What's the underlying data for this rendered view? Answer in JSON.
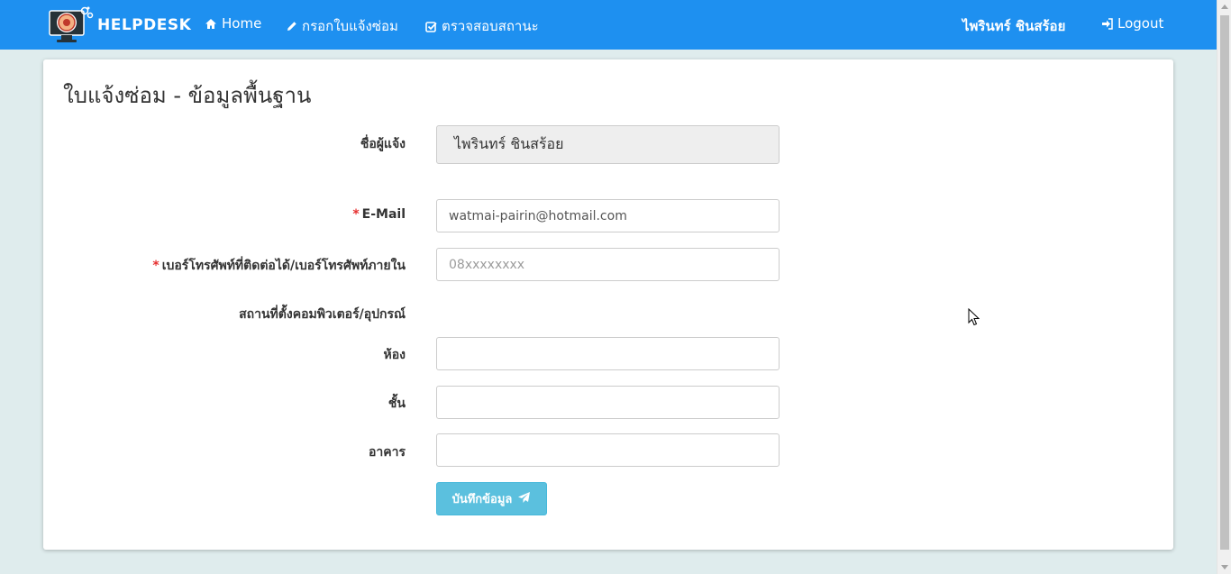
{
  "navbar": {
    "brand": "HELPDESK",
    "home": "Home",
    "report": "กรอกใบแจ้งซ่อม",
    "status": "ตรวจสอบสถานะ",
    "user": "ไพรินทร์ ชินสร้อย",
    "logout": "Logout"
  },
  "form": {
    "title": "ใบแจ้งซ่อม - ข้อมูลพื้นฐาน",
    "reporter_label": "ชื่อผู้แจ้ง",
    "reporter_value": "ไพรินทร์ ชินสร้อย",
    "required_mark": "*",
    "email_label": "E-Mail",
    "email_value": "watmai-pairin@hotmail.com",
    "phone_label": "เบอร์โทรศัพท์ที่ติดต่อได้/เบอร์โทรศัพท์ภายใน",
    "phone_placeholder": "08xxxxxxxx",
    "location_label": "สถานที่ตั้งคอมพิวเตอร์/อุปกรณ์",
    "room_label": "ห้อง",
    "floor_label": "ชั้น",
    "building_label": "อาคาร",
    "submit_label": "บันทึกข้อมูล"
  },
  "colors": {
    "navbar": "#1e90f0",
    "page_background": "#dfeced",
    "button": "#5bc0de",
    "required": "#e62e2e"
  },
  "icons": {
    "home": "home-icon",
    "report": "pencil-icon",
    "status": "check-square-icon",
    "logout": "sign-in-icon",
    "submit": "paper-plane-icon"
  }
}
